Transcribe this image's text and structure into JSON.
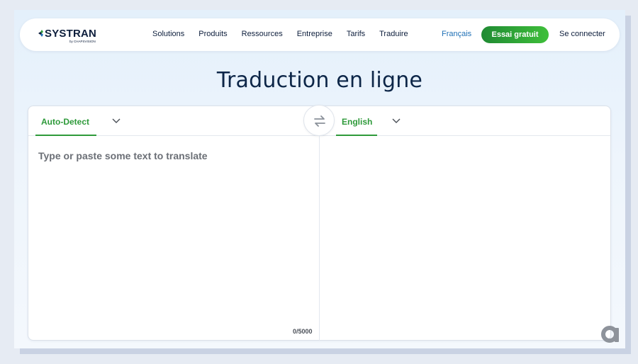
{
  "colors": {
    "accent_green": "#2e9a3a",
    "navy": "#0d2648",
    "link_blue": "#1e6fb5"
  },
  "nav": {
    "logo_text": "SYSTRAN",
    "logo_sub": "by CHAPSVISION",
    "links": [
      "Solutions",
      "Produits",
      "Ressources",
      "Entreprise",
      "Tarifs",
      "Traduire"
    ],
    "language": "Français",
    "trial_label": "Essai gratuit",
    "login_label": "Se connecter"
  },
  "page": {
    "title": "Traduction en ligne"
  },
  "translator": {
    "source_language": "Auto-Detect",
    "target_language": "English",
    "source_placeholder": "Type or paste some text to translate",
    "source_value": "",
    "char_count": "0/5000",
    "swap_icon": "swap-arrows-icon",
    "chevron_icon": "chevron-down-icon"
  }
}
